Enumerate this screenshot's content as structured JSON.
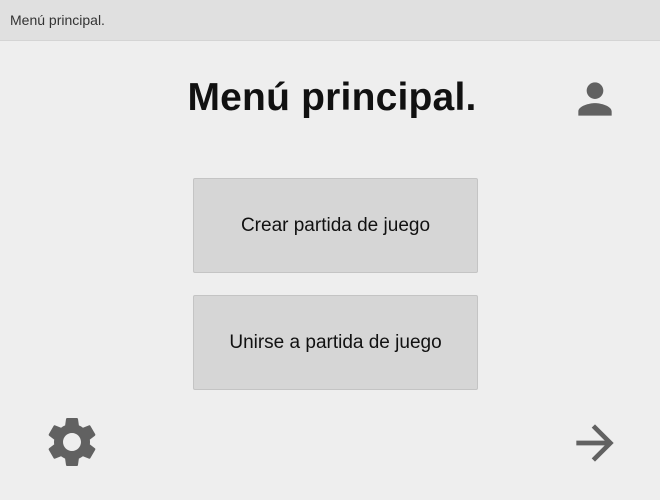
{
  "window": {
    "title": "Menú principal."
  },
  "main": {
    "heading": "Menú principal.",
    "buttons": [
      {
        "label": "Crear partida de juego"
      },
      {
        "label": "Unirse a partida de juego"
      }
    ]
  },
  "icons": {
    "profile": "user-icon",
    "settings": "gear-icon",
    "next": "arrow-right-icon",
    "color": "#616161"
  }
}
